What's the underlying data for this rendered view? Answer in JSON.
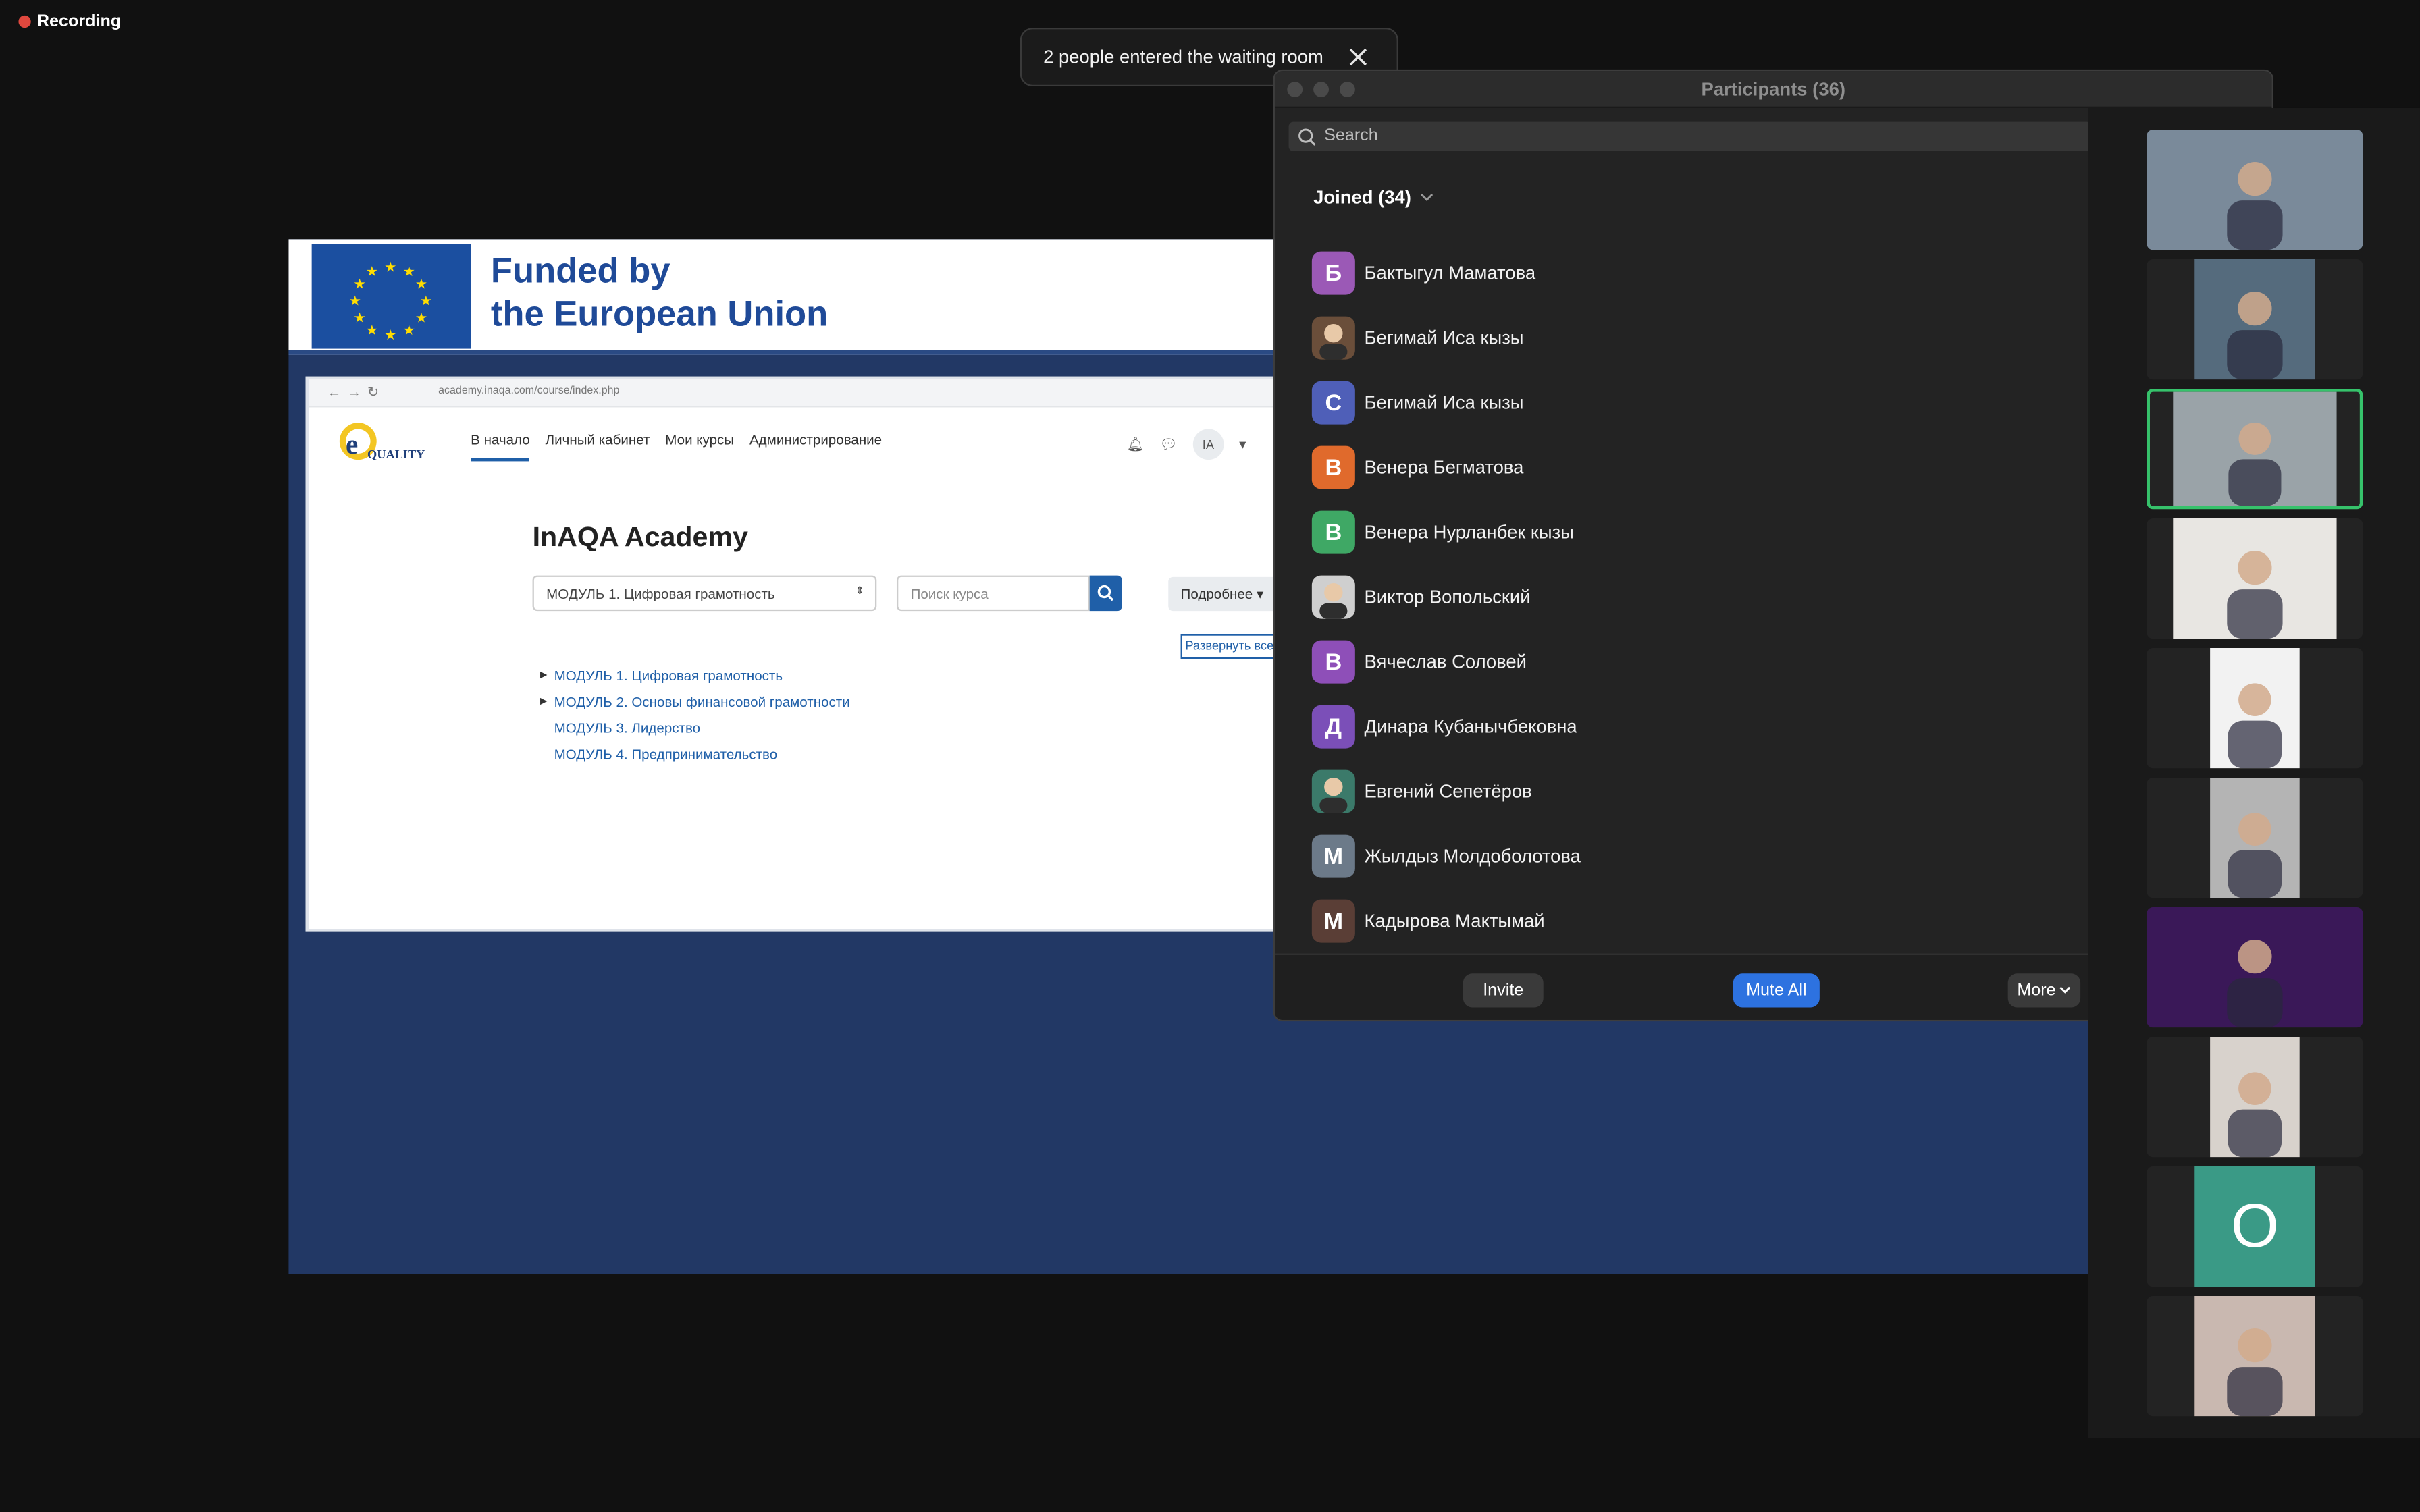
{
  "recording": {
    "label": "Recording"
  },
  "notification": {
    "text": "2 people entered the waiting room"
  },
  "slide": {
    "banner_line1": "Funded by",
    "banner_line2": "the European Union",
    "browser_url": "academy.inaqa.com/course/index.php",
    "site_logo_text": "QUALITY",
    "nav": [
      "В начало",
      "Личный кабинет",
      "Мои курсы",
      "Администрирование"
    ],
    "user_initials": "IA",
    "page_title": "InAQA Academy",
    "category_select": "МОДУЛЬ 1. Цифровая грамотность",
    "course_search_placeholder": "Поиск курса",
    "more_button": "Подробнее",
    "expand_link": "Развернуть все",
    "modules": [
      "МОДУЛЬ 1. Цифровая грамотность",
      "МОДУЛЬ 2. Основы финансовой грамотности",
      "МОДУЛЬ 3. Лидерство",
      "МОДУЛЬ 4. Предпринимательство"
    ]
  },
  "participants_panel": {
    "title": "Participants (36)",
    "search_placeholder": "Search",
    "joined_label": "Joined (34)",
    "participants": [
      {
        "name": "Бактыгул Маматова",
        "initial": "Б",
        "color": "#9b59b6",
        "photo": false
      },
      {
        "name": "Бегимай Иса кызы",
        "initial": "",
        "color": "#6a4e3a",
        "photo": true
      },
      {
        "name": "Бегимай Иса кызы",
        "initial": "C",
        "color": "#4f5fb8",
        "photo": false
      },
      {
        "name": "Венера Бегматова",
        "initial": "B",
        "color": "#e06a2c",
        "photo": false
      },
      {
        "name": "Венера Нурланбек кызы",
        "initial": "B",
        "color": "#3fa865",
        "photo": false
      },
      {
        "name": "Виктор Вопольский",
        "initial": "",
        "color": "#cfcfcf",
        "photo": true
      },
      {
        "name": "Вячеслав Соловей",
        "initial": "B",
        "color": "#8e4fb8",
        "photo": false
      },
      {
        "name": "Динара Кубанычбековна",
        "initial": "Д",
        "color": "#7b4fb8",
        "photo": false
      },
      {
        "name": "Евгений Сепетёров",
        "initial": "",
        "color": "#3b7a6a",
        "photo": true
      },
      {
        "name": "Жылдыз Молдоболотова",
        "initial": "M",
        "color": "#6c7a89",
        "photo": false
      },
      {
        "name": "Кадырова Мактымай",
        "initial": "M",
        "color": "#5a3e36",
        "photo": false
      }
    ],
    "buttons": {
      "invite": "Invite",
      "mute_all": "Mute All",
      "more": "More"
    }
  },
  "video_strip": {
    "tiles": [
      {
        "kind": "camera",
        "bg": "#7a8a9a",
        "active": false
      },
      {
        "kind": "camera",
        "bg": "#556b7d",
        "active": false
      },
      {
        "kind": "camera",
        "bg": "#9aa3a8",
        "active": true
      },
      {
        "kind": "camera",
        "bg": "#e8e6e2",
        "active": false
      },
      {
        "kind": "camera",
        "bg": "#f2f2f2",
        "active": false
      },
      {
        "kind": "camera",
        "bg": "#b4b4b4",
        "active": false
      },
      {
        "kind": "camera",
        "bg": "#3a1858",
        "active": false
      },
      {
        "kind": "camera",
        "bg": "#d8d2cc",
        "active": false
      },
      {
        "kind": "initial",
        "bg": "#3a9a86",
        "active": false,
        "label": "O"
      },
      {
        "kind": "camera",
        "bg": "#c9b8b0",
        "active": false
      }
    ]
  },
  "colors": {
    "accent": "#2d72e0",
    "active_speaker": "#36c26b",
    "recording": "#e0483e",
    "eu_blue": "#1b4fa0"
  }
}
